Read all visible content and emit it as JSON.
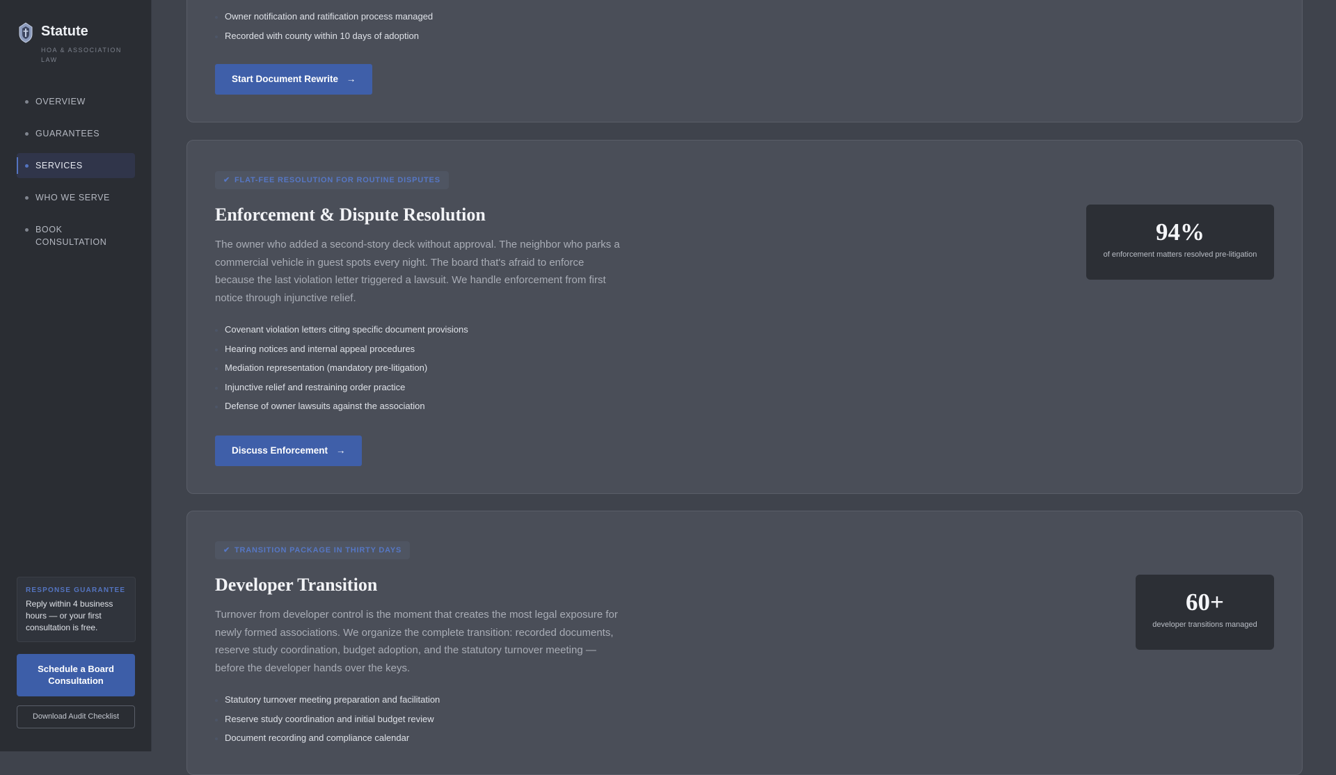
{
  "brand": {
    "name": "Statute",
    "tagline": "HOA & ASSOCIATION LAW",
    "icon": "shield-badge-icon"
  },
  "nav": {
    "items": [
      {
        "label": "OVERVIEW",
        "active": false
      },
      {
        "label": "GUARANTEES",
        "active": false
      },
      {
        "label": "SERVICES",
        "active": true
      },
      {
        "label": "WHO WE SERVE",
        "active": false
      },
      {
        "label": "BOOK CONSULTATION",
        "active": false
      }
    ]
  },
  "guarantee": {
    "title": "RESPONSE GUARANTEE",
    "text": "Reply within 4 business hours — or your first consultation is free."
  },
  "sidebar_ctas": {
    "primary": "Schedule a Board Consultation",
    "secondary": "Download Audit Checklist"
  },
  "services": [
    {
      "bullets": [
        "Owner notification and ratification process managed",
        "Recorded with county within 10 days of adoption"
      ],
      "button": "Start Document Rewrite"
    },
    {
      "badge": "FLAT-FEE RESOLUTION FOR ROUTINE DISPUTES",
      "title": "Enforcement & Dispute Resolution",
      "description": "The owner who added a second-story deck without approval. The neighbor who parks a commercial vehicle in guest spots every night. The board that's afraid to enforce because the last violation letter triggered a lawsuit. We handle enforcement from first notice through injunctive relief.",
      "bullets": [
        "Covenant violation letters citing specific document provisions",
        "Hearing notices and internal appeal procedures",
        "Mediation representation (mandatory pre-litigation)",
        "Injunctive relief and restraining order practice",
        "Defense of owner lawsuits against the association"
      ],
      "button": "Discuss Enforcement",
      "stat": {
        "value": "94%",
        "label": "of enforcement matters resolved pre-litigation"
      }
    },
    {
      "badge": "TRANSITION PACKAGE IN THIRTY DAYS",
      "title": "Developer Transition",
      "description": "Turnover from developer control is the moment that creates the most legal exposure for newly formed associations. We organize the complete transition: recorded documents, reserve study coordination, budget adoption, and the statutory turnover meeting — before the developer hands over the keys.",
      "bullets": [
        "Statutory turnover meeting preparation and facilitation",
        "Reserve study coordination and initial budget review",
        "Document recording and compliance calendar"
      ],
      "stat": {
        "value": "60+",
        "label": "developer transitions managed"
      }
    }
  ],
  "colors": {
    "accent": "#3f5fa9",
    "accent_text": "#5677c4",
    "background": "#3f434c",
    "card": "#4a4e58",
    "sidebar": "#2a2d33"
  }
}
